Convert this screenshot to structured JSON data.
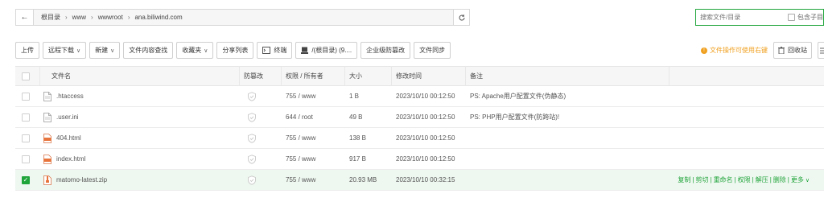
{
  "path": {
    "crumbs": [
      "根目录",
      "www",
      "wwwroot",
      "ana.biliwind.com"
    ],
    "separator": "›"
  },
  "search": {
    "placeholder": "搜索文件/目录",
    "include_sub_label": "包含子目"
  },
  "toolbar": {
    "buttons": [
      {
        "label": "上传"
      },
      {
        "label": "远程下载",
        "dropdown": true
      },
      {
        "label": "新建",
        "dropdown": true
      },
      {
        "label": "文件内容查找"
      },
      {
        "label": "收藏夹",
        "dropdown": true
      },
      {
        "label": "分享列表"
      },
      {
        "label": "终端"
      },
      {
        "label": "/(根目录) (9...."
      },
      {
        "label": "企业级防篡改"
      },
      {
        "label": "文件同步"
      }
    ],
    "tip": "文件操作可使用右键",
    "recycle_label": "回收站"
  },
  "table": {
    "headers": {
      "name": "文件名",
      "protect": "防篡改",
      "perm": "权限 / 所有者",
      "size": "大小",
      "mtime": "修改时间",
      "note": "备注"
    },
    "rows": [
      {
        "name": ".htaccess",
        "type": "file",
        "perm": "755 / www",
        "size": "1 B",
        "mtime": "2023/10/10 00:12:50",
        "note": "PS: Apache用户配置文件(伪静态)",
        "selected": false
      },
      {
        "name": ".user.ini",
        "type": "file",
        "perm": "644 / root",
        "size": "49 B",
        "mtime": "2023/10/10 00:12:50",
        "note": "PS: PHP用户配置文件(防跨站)!",
        "selected": false
      },
      {
        "name": "404.html",
        "type": "html",
        "perm": "755 / www",
        "size": "138 B",
        "mtime": "2023/10/10 00:12:50",
        "note": "",
        "selected": false
      },
      {
        "name": "index.html",
        "type": "html",
        "perm": "755 / www",
        "size": "917 B",
        "mtime": "2023/10/10 00:12:50",
        "note": "",
        "selected": false
      },
      {
        "name": "matomo-latest.zip",
        "type": "zip",
        "perm": "755 / www",
        "size": "20.93 MB",
        "mtime": "2023/10/10 00:32:15",
        "note": "",
        "selected": true
      }
    ],
    "row_ops": [
      "复制",
      "剪切",
      "重命名",
      "权限",
      "解压",
      "删除",
      "更多"
    ]
  },
  "colors": {
    "accent": "#20a53a",
    "warning": "#f0a020",
    "header_bg": "#f6f6f6",
    "selected_row_bg": "#eef7f0"
  }
}
